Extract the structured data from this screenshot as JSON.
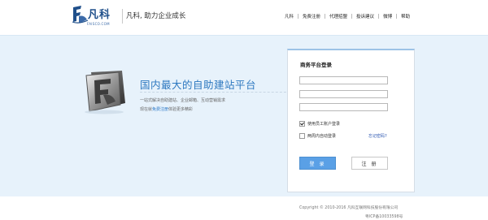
{
  "header": {
    "logo_text": "凡科",
    "logo_sub": "FAISCO.COM",
    "slogan": "凡科, 助力企业成长",
    "nav": [
      "凡科",
      "免费注册",
      "代理招盟",
      "投诉建议",
      "微博",
      "帮助"
    ]
  },
  "hero": {
    "headline": "国内最大的自助建站平台",
    "description": "一站式解决自助建站、企业邮箱、互动营销需求",
    "invite_prefix": "现在就",
    "invite_link": "免费注册",
    "invite_suffix": "体验更多精彩"
  },
  "login": {
    "title": "商务平台登录",
    "username_value": "",
    "password_value": "",
    "code_value": "",
    "employee_login_label": "使用员工账户登录",
    "employee_login_checked": true,
    "auto_login_label": "两周内自动登录",
    "auto_login_checked": false,
    "forgot_label": "忘记密码?",
    "login_button": "登 录",
    "register_button": "注 册"
  },
  "footer": {
    "copyright": "Copyright © 2010-2016 凡科互联网科技股份有限公司",
    "icp": "粤ICP备10033598号"
  },
  "colors": {
    "brand": "#1f4f8a",
    "accent": "#2d78c0",
    "band": "#e7f2fb",
    "login_button": "#5aa0e6"
  }
}
